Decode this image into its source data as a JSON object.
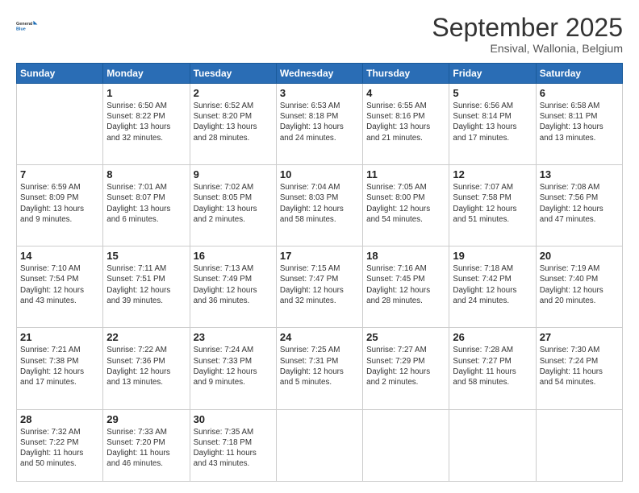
{
  "logo": {
    "line1": "General",
    "line2": "Blue"
  },
  "header": {
    "month": "September 2025",
    "location": "Ensival, Wallonia, Belgium"
  },
  "weekdays": [
    "Sunday",
    "Monday",
    "Tuesday",
    "Wednesday",
    "Thursday",
    "Friday",
    "Saturday"
  ],
  "weeks": [
    [
      {
        "day": "",
        "content": ""
      },
      {
        "day": "1",
        "content": "Sunrise: 6:50 AM\nSunset: 8:22 PM\nDaylight: 13 hours\nand 32 minutes."
      },
      {
        "day": "2",
        "content": "Sunrise: 6:52 AM\nSunset: 8:20 PM\nDaylight: 13 hours\nand 28 minutes."
      },
      {
        "day": "3",
        "content": "Sunrise: 6:53 AM\nSunset: 8:18 PM\nDaylight: 13 hours\nand 24 minutes."
      },
      {
        "day": "4",
        "content": "Sunrise: 6:55 AM\nSunset: 8:16 PM\nDaylight: 13 hours\nand 21 minutes."
      },
      {
        "day": "5",
        "content": "Sunrise: 6:56 AM\nSunset: 8:14 PM\nDaylight: 13 hours\nand 17 minutes."
      },
      {
        "day": "6",
        "content": "Sunrise: 6:58 AM\nSunset: 8:11 PM\nDaylight: 13 hours\nand 13 minutes."
      }
    ],
    [
      {
        "day": "7",
        "content": "Sunrise: 6:59 AM\nSunset: 8:09 PM\nDaylight: 13 hours\nand 9 minutes."
      },
      {
        "day": "8",
        "content": "Sunrise: 7:01 AM\nSunset: 8:07 PM\nDaylight: 13 hours\nand 6 minutes."
      },
      {
        "day": "9",
        "content": "Sunrise: 7:02 AM\nSunset: 8:05 PM\nDaylight: 13 hours\nand 2 minutes."
      },
      {
        "day": "10",
        "content": "Sunrise: 7:04 AM\nSunset: 8:03 PM\nDaylight: 12 hours\nand 58 minutes."
      },
      {
        "day": "11",
        "content": "Sunrise: 7:05 AM\nSunset: 8:00 PM\nDaylight: 12 hours\nand 54 minutes."
      },
      {
        "day": "12",
        "content": "Sunrise: 7:07 AM\nSunset: 7:58 PM\nDaylight: 12 hours\nand 51 minutes."
      },
      {
        "day": "13",
        "content": "Sunrise: 7:08 AM\nSunset: 7:56 PM\nDaylight: 12 hours\nand 47 minutes."
      }
    ],
    [
      {
        "day": "14",
        "content": "Sunrise: 7:10 AM\nSunset: 7:54 PM\nDaylight: 12 hours\nand 43 minutes."
      },
      {
        "day": "15",
        "content": "Sunrise: 7:11 AM\nSunset: 7:51 PM\nDaylight: 12 hours\nand 39 minutes."
      },
      {
        "day": "16",
        "content": "Sunrise: 7:13 AM\nSunset: 7:49 PM\nDaylight: 12 hours\nand 36 minutes."
      },
      {
        "day": "17",
        "content": "Sunrise: 7:15 AM\nSunset: 7:47 PM\nDaylight: 12 hours\nand 32 minutes."
      },
      {
        "day": "18",
        "content": "Sunrise: 7:16 AM\nSunset: 7:45 PM\nDaylight: 12 hours\nand 28 minutes."
      },
      {
        "day": "19",
        "content": "Sunrise: 7:18 AM\nSunset: 7:42 PM\nDaylight: 12 hours\nand 24 minutes."
      },
      {
        "day": "20",
        "content": "Sunrise: 7:19 AM\nSunset: 7:40 PM\nDaylight: 12 hours\nand 20 minutes."
      }
    ],
    [
      {
        "day": "21",
        "content": "Sunrise: 7:21 AM\nSunset: 7:38 PM\nDaylight: 12 hours\nand 17 minutes."
      },
      {
        "day": "22",
        "content": "Sunrise: 7:22 AM\nSunset: 7:36 PM\nDaylight: 12 hours\nand 13 minutes."
      },
      {
        "day": "23",
        "content": "Sunrise: 7:24 AM\nSunset: 7:33 PM\nDaylight: 12 hours\nand 9 minutes."
      },
      {
        "day": "24",
        "content": "Sunrise: 7:25 AM\nSunset: 7:31 PM\nDaylight: 12 hours\nand 5 minutes."
      },
      {
        "day": "25",
        "content": "Sunrise: 7:27 AM\nSunset: 7:29 PM\nDaylight: 12 hours\nand 2 minutes."
      },
      {
        "day": "26",
        "content": "Sunrise: 7:28 AM\nSunset: 7:27 PM\nDaylight: 11 hours\nand 58 minutes."
      },
      {
        "day": "27",
        "content": "Sunrise: 7:30 AM\nSunset: 7:24 PM\nDaylight: 11 hours\nand 54 minutes."
      }
    ],
    [
      {
        "day": "28",
        "content": "Sunrise: 7:32 AM\nSunset: 7:22 PM\nDaylight: 11 hours\nand 50 minutes."
      },
      {
        "day": "29",
        "content": "Sunrise: 7:33 AM\nSunset: 7:20 PM\nDaylight: 11 hours\nand 46 minutes."
      },
      {
        "day": "30",
        "content": "Sunrise: 7:35 AM\nSunset: 7:18 PM\nDaylight: 11 hours\nand 43 minutes."
      },
      {
        "day": "",
        "content": ""
      },
      {
        "day": "",
        "content": ""
      },
      {
        "day": "",
        "content": ""
      },
      {
        "day": "",
        "content": ""
      }
    ]
  ]
}
